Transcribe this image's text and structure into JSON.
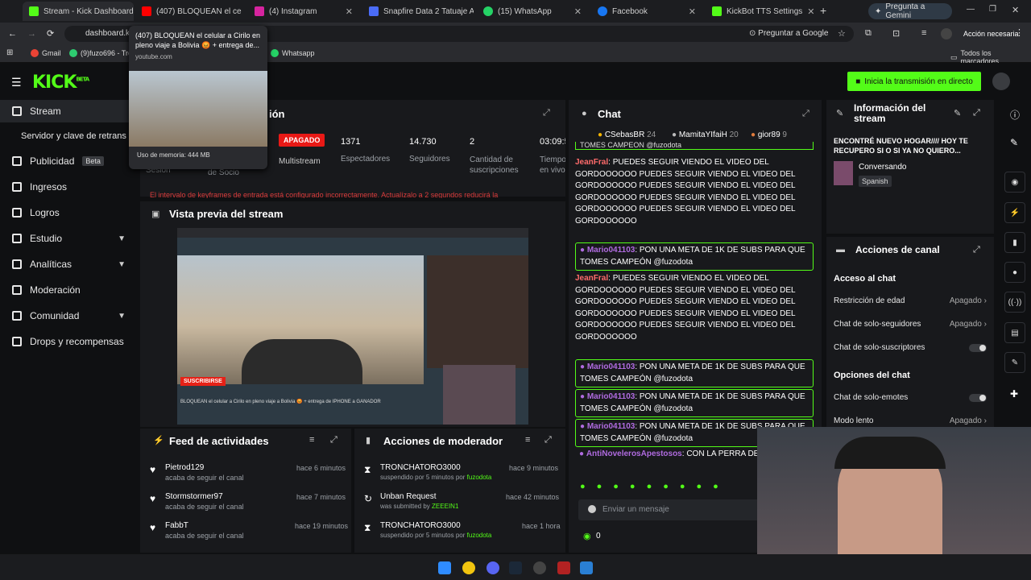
{
  "tabs": [
    {
      "label": "Stream - Kick Dashboard",
      "color": "#53fc18"
    },
    {
      "label": "(407) BLOQUEAN el ce",
      "color": "#ff0000"
    },
    {
      "label": "(4) Instagram",
      "color": "#d6249f"
    },
    {
      "label": "Snapfire Data 2 Tatuaje Ac",
      "color": "#4a6cf7"
    },
    {
      "label": "(15) WhatsApp",
      "color": "#25d366"
    },
    {
      "label": "Facebook",
      "color": "#1877f2"
    },
    {
      "label": "KickBot TTS Settings",
      "color": "#53fc18"
    }
  ],
  "gemini_label": "Pregunta a Gemini",
  "address": {
    "url": "dashboard.kic",
    "ask_google": "Preguntar a Google",
    "action": "Acción necesaria"
  },
  "bookmarks": [
    {
      "label": "Gmail"
    },
    {
      "label": "(9)fuzo696 - Trov"
    },
    {
      "label": "Whatsapp"
    }
  ],
  "bookmarks_all": "Todos los marcadores",
  "tooltip": {
    "title": "(407) BLOQUEAN el celular a Cirilo en pleno viaje a Bolivia 😡 + entrega de...",
    "domain": "youtube.com",
    "memory": "Uso de memoria: 444 MB"
  },
  "kick": {
    "logo": "KICK",
    "beta": "BETA",
    "go_live": "Inicia la transmisión en directo"
  },
  "sidebar": [
    {
      "label": "Stream",
      "active": true
    },
    {
      "label": "Servidor y clave de retrans"
    },
    {
      "label": "Publicidad",
      "badge": "Beta"
    },
    {
      "label": "Ingresos"
    },
    {
      "label": "Logros"
    },
    {
      "label": "Estudio",
      "chevron": true
    },
    {
      "label": "Analíticas",
      "chevron": true
    },
    {
      "label": "Moderación"
    },
    {
      "label": "Comunidad",
      "chevron": true
    },
    {
      "label": "Drops y recompensas"
    }
  ],
  "session": {
    "title_partial": "ión",
    "status": "APAGADO",
    "stats": [
      {
        "value": "1371",
        "label": "Espectadores"
      },
      {
        "value": "14.730",
        "label": "Seguidores"
      },
      {
        "value": "2",
        "label": "Cantidad de suscripciones"
      },
      {
        "value": "03:09:5",
        "label": "Tiempo en vivo"
      }
    ],
    "multistream": "Multistream",
    "sesion_label": "Sesión",
    "socio_label": "de Socio",
    "warning": "El intervalo de keyframes de entrada está configurado incorrectamente. Actualízalo a 2 segundos reducirá la"
  },
  "preview": {
    "title": "Vista previa del stream",
    "subscribe": "SUSCRIBIRSE",
    "caption": "BLOQUEAN el celular a Cirilo en pleno viaje a Bolivia 😡 + entrega de IPHONE a GANADOR"
  },
  "activity": {
    "title": "Feed de actividades",
    "items": [
      {
        "name": "Pietrod129",
        "action": "acaba de seguir el canal",
        "time": "hace 6 minutos"
      },
      {
        "name": "Stormstormer97",
        "action": "acaba de seguir el canal",
        "time": "hace 7 minutos"
      },
      {
        "name": "FabbT",
        "action": "acaba de seguir el canal",
        "time": "hace 19 minutos"
      }
    ]
  },
  "modactions": {
    "title": "Acciones de moderador",
    "items": [
      {
        "name": "TRONCHATORO3000",
        "action": "suspendido por 5 minutos por",
        "by": "fuzodota",
        "time": "hace 9 minutos"
      },
      {
        "name": "Unban Request",
        "action": "was submitted by",
        "by": "ZEEEIN1",
        "time": "hace 42 minutos"
      },
      {
        "name": "TRONCHATORO3000",
        "action": "suspendido por 5 minutos por",
        "by": "fuzodota",
        "time": "hace 1 hora"
      }
    ]
  },
  "chat": {
    "title": "Chat",
    "top": [
      {
        "name": "CSebasBR",
        "n": "24"
      },
      {
        "name": "MamitaYIfaiH",
        "n": "20"
      },
      {
        "name": "gior89",
        "n": "9"
      }
    ],
    "cut": "TOMES CAMPEÓN @fuzodota",
    "messages": [
      {
        "user": "JeanFral",
        "text": "PUEDES SEGUIR VIENDO EL VIDEO DEL GORDOOOOOO PUEDES SEGUIR VIENDO EL VIDEO DEL GORDOOOOOO PUEDES SEGUIR VIENDO EL VIDEO DEL GORDOOOOOO PUEDES SEGUIR VIENDO EL VIDEO DEL GORDOOOOOO PUEDES SEGUIR VIENDO EL VIDEO DEL GORDOOOOOO",
        "hl": false
      },
      {
        "user": "Mario041103",
        "text": "PON UNA META DE 1K DE SUBS PARA QUE TOMES CAMPEÓN @fuzodota",
        "hl": true
      },
      {
        "user": "JeanFral",
        "text": "PUEDES SEGUIR VIENDO EL VIDEO DEL GORDOOOOOO PUEDES SEGUIR VIENDO EL VIDEO DEL GORDOOOOOO PUEDES SEGUIR VIENDO EL VIDEO DEL GORDOOOOOO PUEDES SEGUIR VIENDO EL VIDEO DEL GORDOOOOOO PUEDES SEGUIR VIENDO EL VIDEO DEL GORDOOOOOO",
        "hl": false
      },
      {
        "user": "Mario041103",
        "text": "PON UNA META DE 1K DE SUBS PARA QUE TOMES CAMPEÓN @fuzodota",
        "hl": true
      },
      {
        "user": "Mario041103",
        "text": "PON UNA META DE 1K DE SUBS PARA QUE TOMES CAMPEÓN @fuzodota",
        "hl": true
      },
      {
        "user": "Mario041103",
        "text": "PON UNA META DE 1K DE SUBS PARA QUE TOMES CAMPEÓN @fuzodota",
        "hl": true
      },
      {
        "user": "AntiNovelerosApestosos",
        "text": "CON LA PERRA DE ***** KCHERA",
        "hl": false
      }
    ],
    "input_placeholder": "Enviar un mensaje",
    "points": "0"
  },
  "info": {
    "title": "Información del stream",
    "stream_title": "ENCONTRÉ NUEVO HOGAR//// HOY TE RECUPERO SI O SI YA NO QUIERO...",
    "category": "Conversando",
    "language": "Spanish"
  },
  "channel": {
    "title": "Acciones de canal",
    "chat_access": "Acceso al chat",
    "settings": [
      {
        "label": "Restricción de edad",
        "value": "Apagado"
      },
      {
        "label": "Chat de solo-seguidores",
        "value": "Apagado"
      },
      {
        "label": "Chat de solo-suscriptores",
        "value": ""
      }
    ],
    "chat_options": "Opciones del chat",
    "settings2": [
      {
        "label": "Chat de solo-emotes",
        "value": ""
      },
      {
        "label": "Modo lento",
        "value": "Apagado"
      }
    ]
  }
}
